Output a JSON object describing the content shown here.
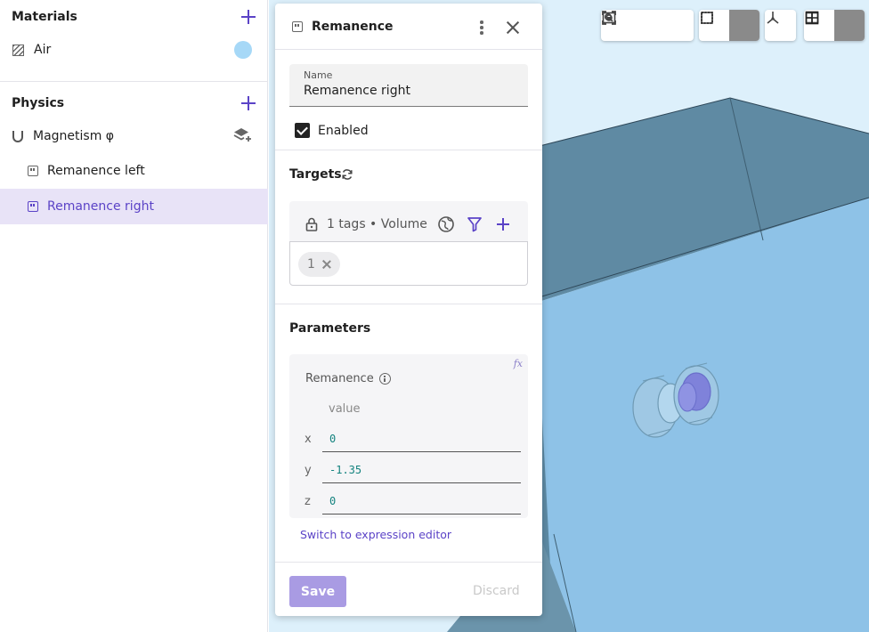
{
  "sidebar": {
    "materials": {
      "title": "Materials",
      "items": [
        {
          "label": "Air",
          "color": "#a6d8f7"
        }
      ]
    },
    "physics": {
      "title": "Physics",
      "model": {
        "label": "Magnetism φ"
      },
      "items": [
        {
          "label": "Remanence left",
          "selected": false
        },
        {
          "label": "Remanence right",
          "selected": true
        }
      ]
    }
  },
  "panel": {
    "title": "Remanence",
    "name_field": {
      "label": "Name",
      "value": "Remanence right"
    },
    "enabled": {
      "label": "Enabled",
      "checked": true
    },
    "targets": {
      "title": "Targets",
      "summary": "1 tags • Volume",
      "chips": [
        "1"
      ]
    },
    "parameters": {
      "title": "Parameters",
      "fx_label": "fx",
      "param_label": "Remanence",
      "column_header": "value",
      "components": [
        {
          "axis": "x",
          "value": "0"
        },
        {
          "axis": "y",
          "value": "-1.35"
        },
        {
          "axis": "z",
          "value": "0"
        }
      ],
      "switch_link": "Switch to expression editor"
    },
    "footer": {
      "save": "Save",
      "discard": "Discard"
    }
  },
  "viewport": {
    "toolbar_groups": [
      [
        "focus-selection-icon",
        "zoom-fit-icon",
        "screenshot-icon"
      ],
      [
        "solid-view-icon",
        "wireframe-view-icon"
      ],
      [
        "axes-icon"
      ],
      [
        "section-view-icon",
        "grid-layout-icon"
      ]
    ],
    "colors": {
      "accent": "#5b43c7",
      "surface_blue": "#8ec2e7",
      "dark_face": "#5f8aa3"
    }
  }
}
